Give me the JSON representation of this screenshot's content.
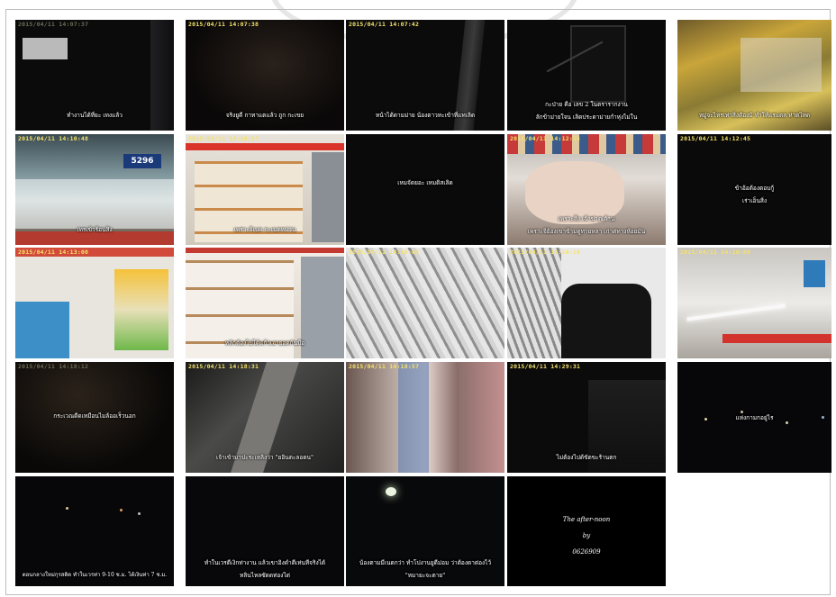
{
  "tiles": [
    {
      "ts": "2015/04/11  14:07:37",
      "caption": "ทำงานได้ที่ยะ เทงแล้ว"
    },
    {
      "ts": "2015/04/11  14:07:38",
      "caption": "จริงยูดี กาทาแตแล้ว ถูก กะเขย"
    },
    {
      "ts": "2015/04/11  14:07:42",
      "caption": "หน้าได้ตามม่าย น้องตาวทะเข้าที่แทเลิด"
    },
    {
      "ts": "",
      "caption": "กะป่าย คือ เลข 2 ในตรารากงาน",
      "caption2": "ลักข้าม่ายใจน เลิดประดาม่ายกำหุ่งไม่ใน"
    },
    {
      "ts": "",
      "caption": "หมู่จะไหรเห่าสิ่งต้องมิ ทำให้แรแดล ห่าตไหด"
    },
    {
      "ts": "2015/04/11  14:10:48",
      "caption": "เทรเข้าร้อนสิง"
    },
    {
      "ts": "2015/04/11  14:10:57",
      "caption": "เพราะจิเบค กะเนดหม่วน"
    },
    {
      "ts": "",
      "caption": "เหมจัดยอะ เหมดิสเลิด"
    },
    {
      "ts": "2015/04/11  14:12:35",
      "caption": "เพราะสิ่ง เจ้าข่าดเก้าน",
      "caption2": "เพราะจิ่ย้องเขาข้ามดูท่ายหลา เก่าต่ทางห้อยมัน"
    },
    {
      "ts": "2015/04/11  14:12:45",
      "caption": "ข้าอ้อต้องตอบกู้",
      "caption2": "เร่าเอ็นสิ่ง"
    },
    {
      "ts": "2015/04/11  14:13:00",
      "caption": ""
    },
    {
      "ts": "",
      "caption": "หลักต้องไปได้แก้วเอายอดกันมือ"
    },
    {
      "ts": "2015/04/11  14:16:03",
      "caption": ""
    },
    {
      "ts": "2015/04/11  14:16:18",
      "caption": ""
    },
    {
      "ts": "2015/04/11  14:18:00",
      "caption": ""
    },
    {
      "ts": "2015/04/11  14:18:12",
      "caption": "กระเวณดีดเหมือนไมล้ออเร็วนอก"
    },
    {
      "ts": "2015/04/11  14:18:31",
      "caption": "เจ้าเข้ามาปะระเหลิงว่า \"ยอินตะลอดน\""
    },
    {
      "ts": "2015/04/11  14:18:57",
      "caption": ""
    },
    {
      "ts": "2015/04/11  14:29:31",
      "caption": "ไม่ต้องไปด้ขัดขะร้านตก"
    },
    {
      "ts": "",
      "caption": "แห่งกามกอยู่ไร"
    },
    {
      "ts": "",
      "caption": "ตอนกลางใหม่กุรสติด ทำในเวรท่า 9-10 ช.ม. ได้เงินท่า 7 ช.ม."
    },
    {
      "ts": "",
      "caption": "ทำในเวรดีเงิกท่างาน แล้วเขาอิงดำดีเห่นทีจริงได้",
      "caption2": "หลินไหลซัดดท่องไต่"
    },
    {
      "ts": "",
      "caption": "น้องตามมีเนดกว่า ทำโปงานยูดีม่อม ว่าต้องดาต่องไว้",
      "caption2": "\"หมายะจะตาย\""
    },
    {
      "ts": "",
      "caption": "The after-noon",
      "caption2": "by",
      "caption3": "0626909"
    }
  ]
}
